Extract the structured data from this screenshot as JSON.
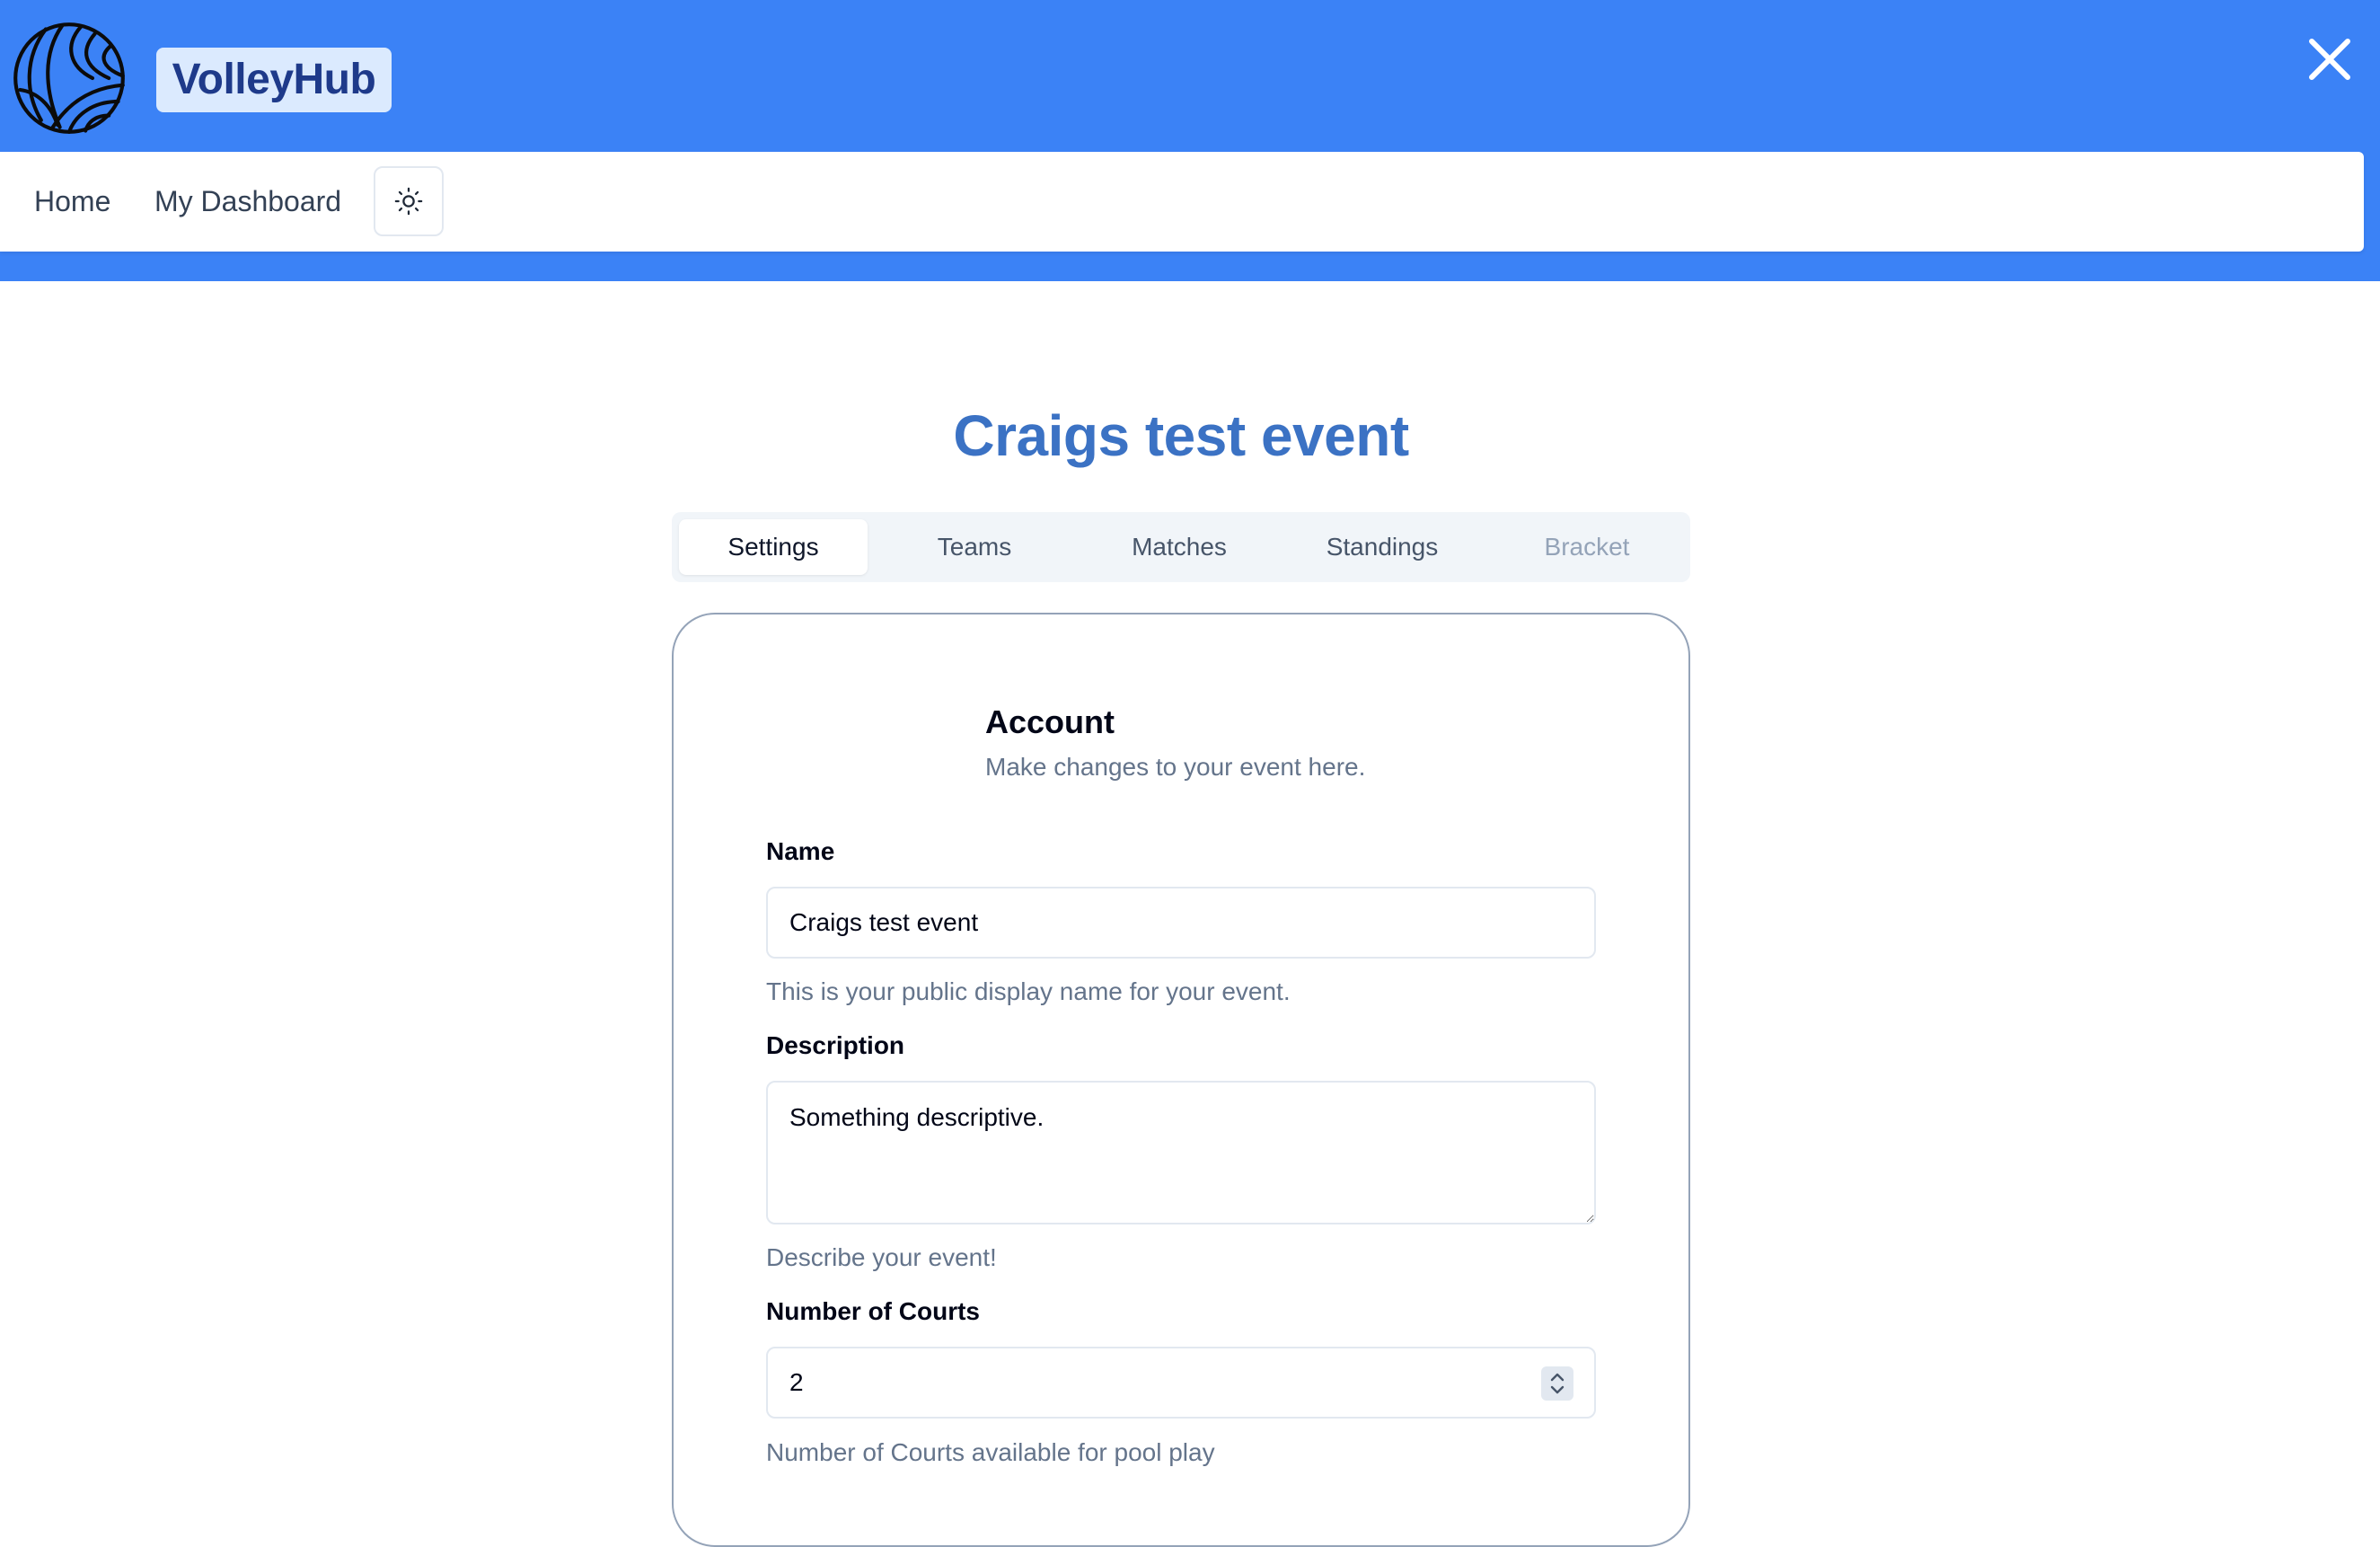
{
  "header": {
    "brand": "VolleyHub",
    "logo_icon": "volleyball-icon",
    "close_icon": "close-icon",
    "background": "#3b82f6"
  },
  "nav": {
    "items": [
      {
        "label": "Home"
      },
      {
        "label": "My Dashboard"
      }
    ],
    "theme_toggle_icon": "sun-icon"
  },
  "event": {
    "title": "Craigs test event"
  },
  "tabs": [
    {
      "label": "Settings",
      "state": "active"
    },
    {
      "label": "Teams",
      "state": "normal"
    },
    {
      "label": "Matches",
      "state": "normal"
    },
    {
      "label": "Standings",
      "state": "normal"
    },
    {
      "label": "Bracket",
      "state": "disabled"
    }
  ],
  "form": {
    "title": "Account",
    "subtitle": "Make changes to your event here.",
    "name": {
      "label": "Name",
      "value": "Craigs test event",
      "help": "This is your public display name for your event."
    },
    "description": {
      "label": "Description",
      "value": "Something descriptive.",
      "help": "Describe your event!"
    },
    "courts": {
      "label": "Number of Courts",
      "value": "2",
      "help": "Number of Courts available for pool play"
    }
  }
}
